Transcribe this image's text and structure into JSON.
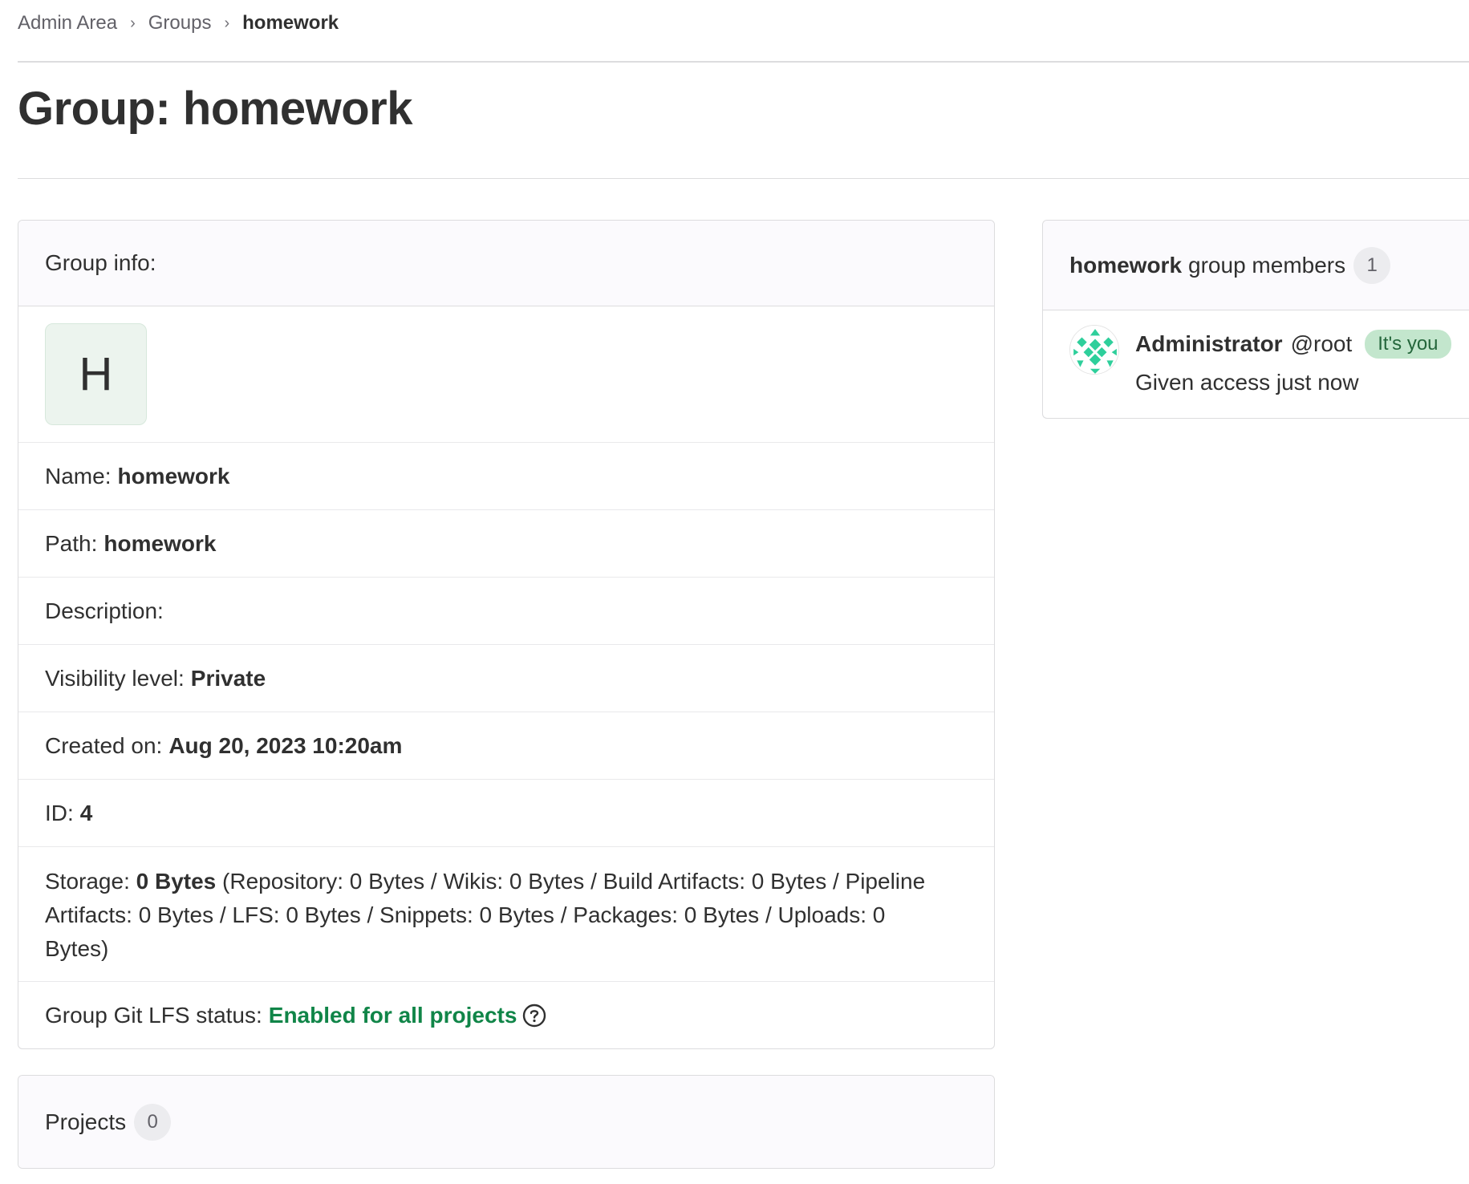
{
  "breadcrumb": {
    "items": [
      "Admin Area",
      "Groups"
    ],
    "current": "homework"
  },
  "page_title": "Group: homework",
  "group_info": {
    "header": "Group info:",
    "avatar_letter": "H",
    "name_label": "Name:",
    "name_value": "homework",
    "path_label": "Path:",
    "path_value": "homework",
    "description_label": "Description:",
    "visibility_label": "Visibility level:",
    "visibility_value": "Private",
    "created_label": "Created on:",
    "created_value": "Aug 20, 2023 10:20am",
    "id_label": "ID:",
    "id_value": "4",
    "storage_label": "Storage:",
    "storage_total": "0 Bytes",
    "storage_detail": "(Repository: 0 Bytes / Wikis: 0 Bytes / Build Artifacts: 0 Bytes / Pipeline Artifacts: 0 Bytes / LFS: 0 Bytes / Snippets: 0 Bytes / Packages: 0 Bytes / Uploads: 0 Bytes)",
    "lfs_label": "Group Git LFS status:",
    "lfs_value": "Enabled for all projects",
    "lfs_help_icon": "question-circle-icon"
  },
  "projects": {
    "label": "Projects",
    "count": "0"
  },
  "members": {
    "group_name": "homework",
    "header_suffix": "group members",
    "count": "1",
    "list": [
      {
        "name": "Administrator",
        "username": "@root",
        "badge": "It's you",
        "access": "Given access just now",
        "avatar_icon": "identicon-avatar"
      }
    ]
  },
  "colors": {
    "lfs_enabled": "#108548",
    "badge_bg": "#c3e6cd",
    "avatar_bg": "#ecf4ee",
    "identicon": "#2ecf9b"
  }
}
